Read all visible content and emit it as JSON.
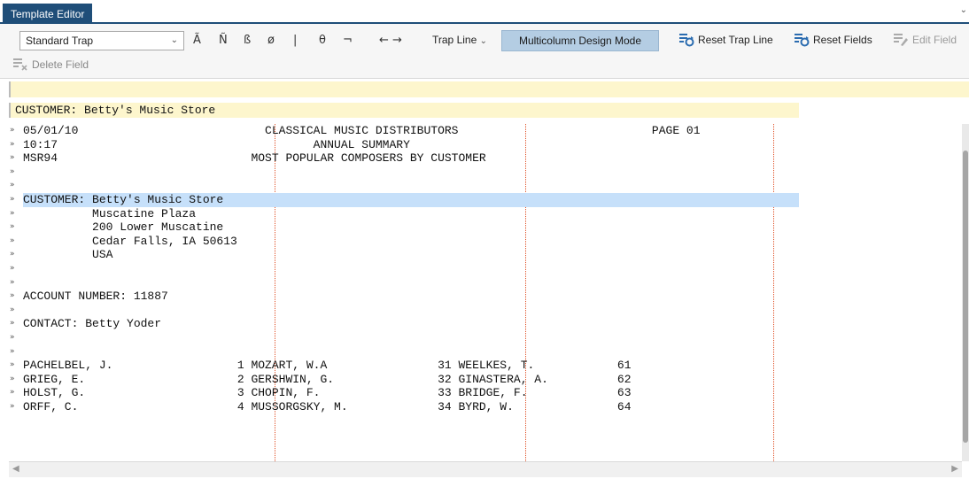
{
  "tab": {
    "label": "Template Editor"
  },
  "toolbar": {
    "trap_type": "Standard Trap",
    "symbols": [
      "Ã",
      "Ñ",
      "ß",
      "ø",
      "|",
      "θ",
      "¬"
    ],
    "arrows": "← →",
    "trap_line_label": "Trap Line",
    "multicolumn_label": "Multicolumn Design Mode",
    "reset_trap_line": "Reset Trap Line",
    "reset_fields": "Reset Fields",
    "edit_field": "Edit Field",
    "delete_field": "Delete Field"
  },
  "trap_line": {
    "text": "CUSTOMER: Betty's Music Store"
  },
  "report": {
    "lines": [
      {
        "mark": "»",
        "text": "05/01/10                           CLASSICAL MUSIC DISTRIBUTORS                            PAGE 01"
      },
      {
        "mark": "»",
        "text": "10:17                                     ANNUAL SUMMARY"
      },
      {
        "mark": "»",
        "text": "MSR94                            MOST POPULAR COMPOSERS BY CUSTOMER"
      },
      {
        "mark": "»",
        "text": ""
      },
      {
        "mark": "»",
        "text": ""
      },
      {
        "mark": "»",
        "text": "CUSTOMER: Betty's Music Store",
        "highlight": true
      },
      {
        "mark": "»",
        "text": "          Muscatine Plaza"
      },
      {
        "mark": "»",
        "text": "          200 Lower Muscatine"
      },
      {
        "mark": "»",
        "text": "          Cedar Falls, IA 50613"
      },
      {
        "mark": "»",
        "text": "          USA"
      },
      {
        "mark": "»",
        "text": ""
      },
      {
        "mark": "»",
        "text": ""
      },
      {
        "mark": "»",
        "text": "ACCOUNT NUMBER: 11887"
      },
      {
        "mark": "»",
        "text": ""
      },
      {
        "mark": "»",
        "text": "CONTACT: Betty Yoder"
      },
      {
        "mark": "»",
        "text": ""
      },
      {
        "mark": "»",
        "text": ""
      },
      {
        "mark": "»",
        "text": "PACHELBEL, J.                  1 MOZART, W.A                31 WEELKES, T.            61"
      },
      {
        "mark": "»",
        "text": "GRIEG, E.                      2 GERSHWIN, G.               32 GINASTERA, A.          62"
      },
      {
        "mark": "»",
        "text": "HOLST, G.                      3 CHOPIN, F.                 33 BRIDGE, F.             63"
      },
      {
        "mark": "»",
        "text": "ORFF, C.                       4 MUSSORGSKY, M.             34 BYRD, W.               64"
      }
    ]
  },
  "colors": {
    "tab_bg": "#1f4e79",
    "active_button_bg": "#b4cde3",
    "trap_band": "#fdf6cd",
    "highlight": "#c6e0fa",
    "column_guides": "#e0532a"
  }
}
